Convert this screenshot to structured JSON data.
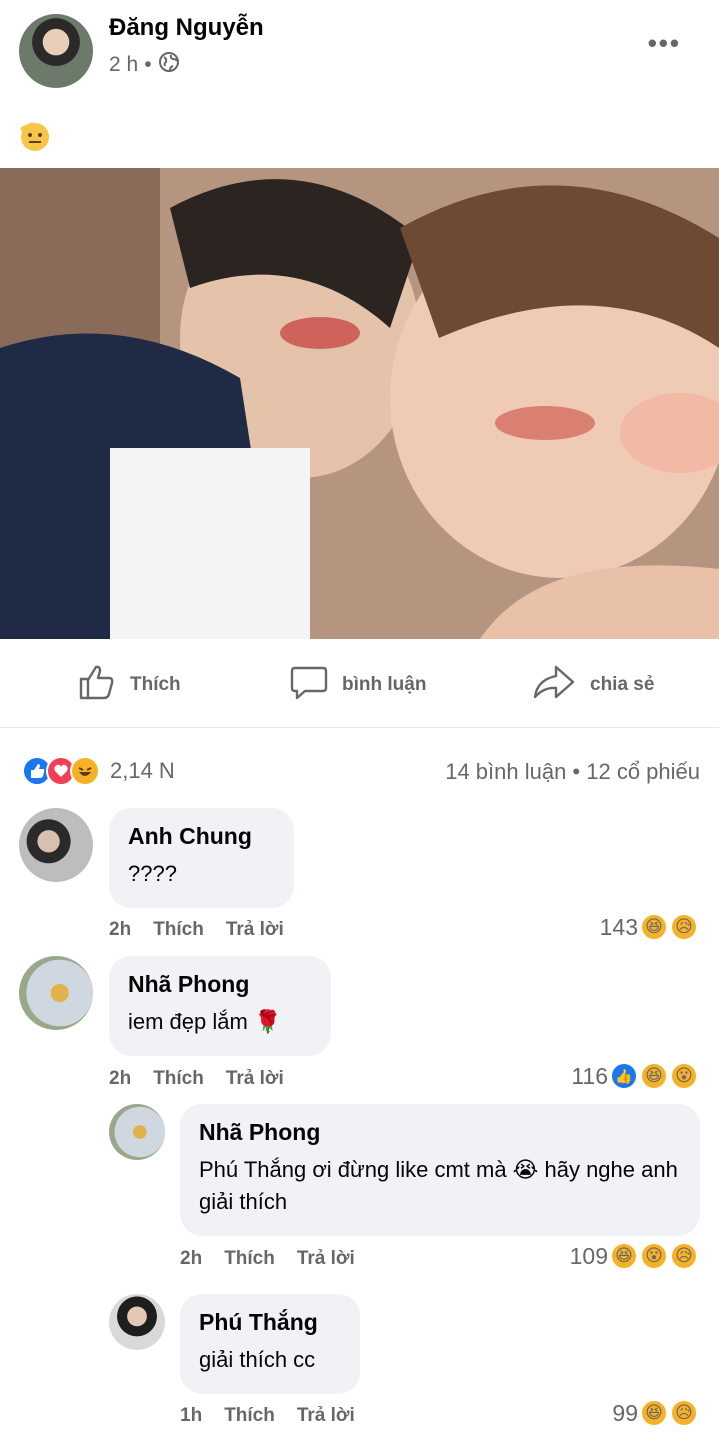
{
  "post": {
    "author": "Đăng Nguyễn",
    "time": "2 h",
    "separator": "•",
    "more_label": "•••",
    "emoji": "🫡"
  },
  "actions": {
    "like": "Thích",
    "comment": "bình luận",
    "share": "chia sẻ"
  },
  "summary": {
    "reaction_count": "2,14 N",
    "comments_shares": "14  bình luận • 12  cổ phiếu"
  },
  "comments": [
    {
      "name": "Anh Chung",
      "text": "????",
      "time": "2h",
      "like": "Thích",
      "reply": "Trả lời",
      "count": "143"
    },
    {
      "name": "Nhã Phong",
      "text": "iem đẹp lắm 🌹",
      "time": "2h",
      "like": "Thích",
      "reply": "Trả lời",
      "count": "116"
    },
    {
      "name": "Nhã Phong",
      "text": "Phú Thắng ơi đừng like cmt mà 😭 hãy nghe anh giải thích",
      "time": "2h",
      "like": "Thích",
      "reply": "Trả lời",
      "count": "109"
    },
    {
      "name": "Phú Thắng",
      "text": "giải thích cc",
      "time": "1h",
      "like": "Thích",
      "reply": "Trả lời",
      "count": "99"
    }
  ],
  "colors": {
    "like_blue": "#1877f2",
    "love_red": "#f33e58",
    "haha_yellow": "#f7b125",
    "muted": "#65676b",
    "bubble": "#f0f2f5"
  }
}
